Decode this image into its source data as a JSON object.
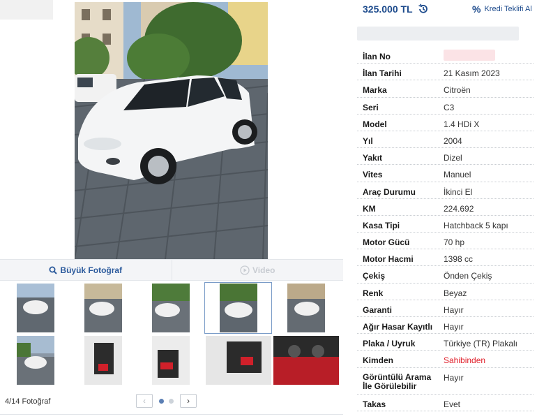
{
  "price": {
    "amount": "325.000 TL",
    "history_icon": "history-icon"
  },
  "credit": {
    "icon": "percent-icon",
    "label": "Kredi Teklifi Al"
  },
  "photo_toolbar": {
    "big_photo": "Büyük Fotoğraf",
    "video": "Video",
    "search_icon": "magnifier-icon",
    "play_icon": "play-circle-icon"
  },
  "gallery": {
    "counter": "4/14 Fotoğraf",
    "prev": "‹",
    "next": "›",
    "selected_index": 4,
    "total": 14
  },
  "specs": [
    {
      "key": "İlan No",
      "value": ""
    },
    {
      "key": "İlan Tarihi",
      "value": "21 Kasım 2023"
    },
    {
      "key": "Marka",
      "value": "Citroën"
    },
    {
      "key": "Seri",
      "value": "C3"
    },
    {
      "key": "Model",
      "value": "1.4 HDi X"
    },
    {
      "key": "Yıl",
      "value": "2004"
    },
    {
      "key": "Yakıt",
      "value": "Dizel"
    },
    {
      "key": "Vites",
      "value": "Manuel"
    },
    {
      "key": "Araç Durumu",
      "value": "İkinci El"
    },
    {
      "key": "KM",
      "value": "224.692"
    },
    {
      "key": "Kasa Tipi",
      "value": "Hatchback 5 kapı"
    },
    {
      "key": "Motor Gücü",
      "value": "70 hp"
    },
    {
      "key": "Motor Hacmi",
      "value": "1398 cc"
    },
    {
      "key": "Çekiş",
      "value": "Önden Çekiş"
    },
    {
      "key": "Renk",
      "value": "Beyaz"
    },
    {
      "key": "Garanti",
      "value": "Hayır"
    },
    {
      "key": "Ağır Hasar Kayıtlı",
      "value": "Hayır"
    },
    {
      "key": "Plaka / Uyruk",
      "value": "Türkiye (TR) Plakalı"
    },
    {
      "key": "Kimden",
      "value": "Sahibinden"
    },
    {
      "key": "Görüntülü Arama İle Görülebilir",
      "value": "Hayır"
    },
    {
      "key": "Takas",
      "value": "Evet"
    }
  ],
  "colors": {
    "accent": "#1c4a8c",
    "owner_red": "#e0202b"
  }
}
